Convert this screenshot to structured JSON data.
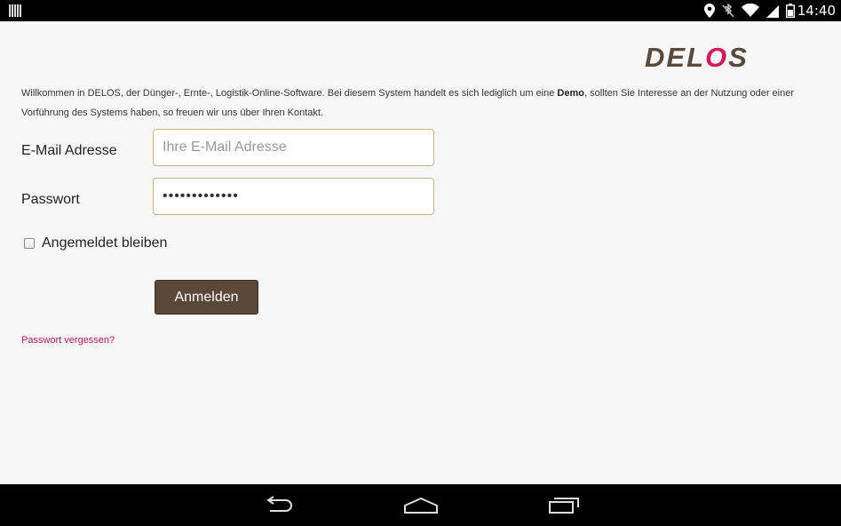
{
  "statusbar": {
    "time": "14:40"
  },
  "logo": {
    "part1": "DEL",
    "part2": "O",
    "part3": "S"
  },
  "intro": {
    "text_before": "Willkommen in DELOS, der Dünger-, Ernte-, Logistik-Online-Software. Bei diesem System handelt es sich lediglich um eine ",
    "bold": "Demo",
    "text_after": ", sollten Sie Interesse an der Nutzung oder einer Vorführung des Systems haben, so freuen wir uns über Ihren Kontakt."
  },
  "form": {
    "email_label": "E-Mail Adresse",
    "email_placeholder": "Ihre E-Mail Adresse",
    "password_label": "Passwort",
    "password_value": "•••••••••••••",
    "remember_label": "Angemeldet bleiben",
    "remember_checked": false,
    "submit_label": "Anmelden",
    "forgot_link": "Passwort vergessen?"
  },
  "icons": {
    "status_left": "barcode-icon",
    "status_right": [
      "location-icon",
      "bluetooth-off-icon",
      "wifi-icon",
      "signal-icon",
      "battery-icon"
    ],
    "nav": [
      "back-icon",
      "home-icon",
      "recent-apps-icon"
    ]
  },
  "colors": {
    "brand": "#5b4a3c",
    "accent": "#d4195c",
    "button": "#5b4738",
    "link": "#c2185b",
    "field_border": "#c8b48a"
  }
}
